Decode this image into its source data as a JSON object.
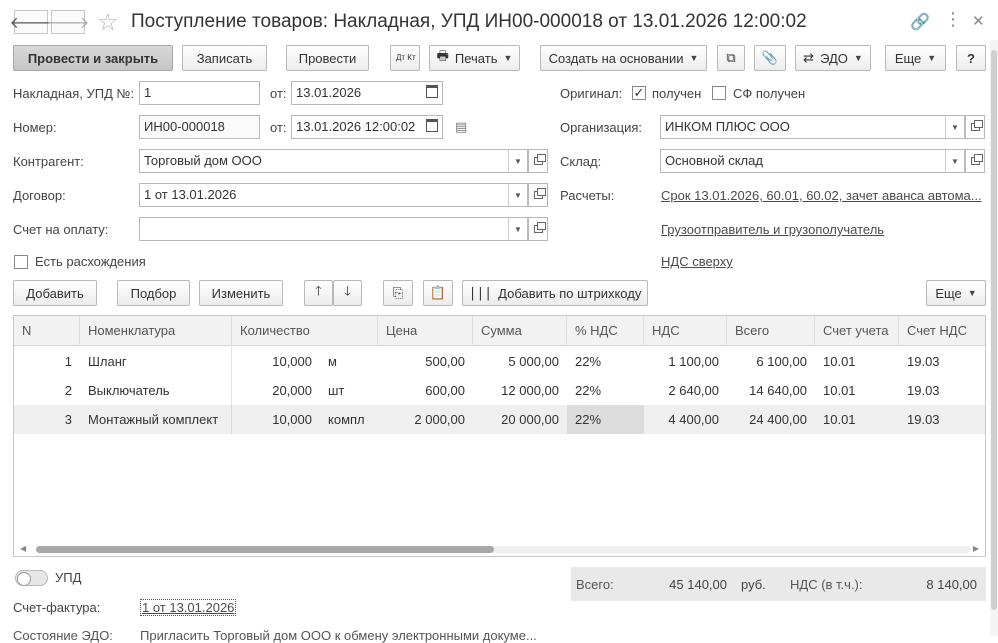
{
  "window": {
    "title": "Поступление товаров: Накладная, УПД ИН00-000018 от 13.01.2026 12:00:02"
  },
  "toolbar": {
    "post_close": "Провести и закрыть",
    "save": "Записать",
    "post": "Провести",
    "dtkt": "Дт Кт",
    "print": "Печать",
    "create_based": "Создать на основании",
    "edo": "ЭДО",
    "more": "Еще",
    "help": "?"
  },
  "form": {
    "invoice_label": "Накладная, УПД №:",
    "invoice_number": "1",
    "from_label": "от:",
    "invoice_date": "13.01.2026",
    "number_label": "Номер:",
    "number": "ИН00-000018",
    "from_label2": "от:",
    "number_date": "13.01.2026 12:00:02",
    "counterparty_label": "Контрагент:",
    "counterparty": "Торговый дом ООО",
    "contract_label": "Договор:",
    "contract": "1 от 13.01.2026",
    "payment_invoice_label": "Счет на оплату:",
    "payment_invoice": "",
    "discrepancies_label": "Есть расхождения",
    "original_label": "Оригинал:",
    "received_label": "получен",
    "sf_received_label": "СФ получен",
    "organization_label": "Организация:",
    "organization": "ИНКОМ ПЛЮС ООО",
    "warehouse_label": "Склад:",
    "warehouse": "Основной склад",
    "settlements_label": "Расчеты:",
    "settlements_link": "Срок 13.01.2026, 60.01, 60.02, зачет аванса автома...",
    "shipper_link": "Грузоотправитель и грузополучатель",
    "vat_link": "НДС сверху"
  },
  "table_toolbar": {
    "add": "Добавить",
    "selection": "Подбор",
    "change": "Изменить",
    "add_barcode": "Добавить по штрихкоду",
    "more": "Еще"
  },
  "table": {
    "headers": [
      "N",
      "Номенклатура",
      "Количество",
      "Цена",
      "Сумма",
      "% НДС",
      "НДС",
      "Всего",
      "Счет учета",
      "Счет НДС"
    ],
    "rows": [
      {
        "n": "1",
        "name": "Шланг",
        "qty": "10,000",
        "unit": "м",
        "price": "500,00",
        "sum": "5 000,00",
        "vat_rate": "22%",
        "vat": "1 100,00",
        "total": "6 100,00",
        "account": "10.01",
        "vat_account": "19.03"
      },
      {
        "n": "2",
        "name": "Выключатель",
        "qty": "20,000",
        "unit": "шт",
        "price": "600,00",
        "sum": "12 000,00",
        "vat_rate": "22%",
        "vat": "2 640,00",
        "total": "14 640,00",
        "account": "10.01",
        "vat_account": "19.03"
      },
      {
        "n": "3",
        "name": "Монтажный комплект",
        "qty": "10,000",
        "unit": "компл",
        "price": "2 000,00",
        "sum": "20 000,00",
        "vat_rate": "22%",
        "vat": "4 400,00",
        "total": "24 400,00",
        "account": "10.01",
        "vat_account": "19.03"
      }
    ]
  },
  "footer": {
    "upd_label": "УПД",
    "total_label": "Всего:",
    "total_value": "45 140,00",
    "currency": "руб.",
    "vat_label": "НДС (в т.ч.):",
    "vat_value": "8 140,00",
    "sf_label": "Счет-фактура:",
    "sf_link": "1 от 13.01.2026",
    "edo_state_label": "Состояние ЭДО:",
    "edo_state_text": "Пригласить Торговый дом ООО к обмену электронными докуме..."
  }
}
